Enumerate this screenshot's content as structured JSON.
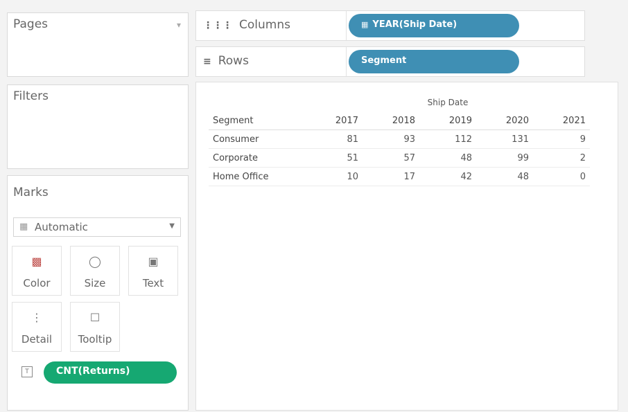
{
  "left_panel": {
    "pages_title": "Pages",
    "filters_title": "Filters",
    "marks_title": "Marks",
    "mark_type": "Automatic",
    "mark_buttons": [
      {
        "label": "Color",
        "icon": "color-icon"
      },
      {
        "label": "Size",
        "icon": "size-icon"
      },
      {
        "label": "Text",
        "icon": "text-icon"
      },
      {
        "label": "Detail",
        "icon": "detail-icon"
      },
      {
        "label": "Tooltip",
        "icon": "tooltip-icon"
      }
    ],
    "text_pill": "CNT(Returns)"
  },
  "shelves": {
    "columns_label": "Columns",
    "columns_pill": "YEAR(Ship Date)",
    "rows_label": "Rows",
    "rows_pill": "Segment"
  },
  "table": {
    "column_group": "Ship Date",
    "row_header": "Segment",
    "years": [
      "2017",
      "2018",
      "2019",
      "2020",
      "2021"
    ],
    "rows": [
      {
        "segment": "Consumer",
        "values": [
          "81",
          "93",
          "112",
          "131",
          "9"
        ]
      },
      {
        "segment": "Corporate",
        "values": [
          "51",
          "57",
          "48",
          "99",
          "2"
        ]
      },
      {
        "segment": "Home Office",
        "values": [
          "10",
          "17",
          "42",
          "48",
          "0"
        ]
      }
    ]
  },
  "colors": {
    "green_pill": "#16a872",
    "blue_pill": "#3f8fb4"
  }
}
